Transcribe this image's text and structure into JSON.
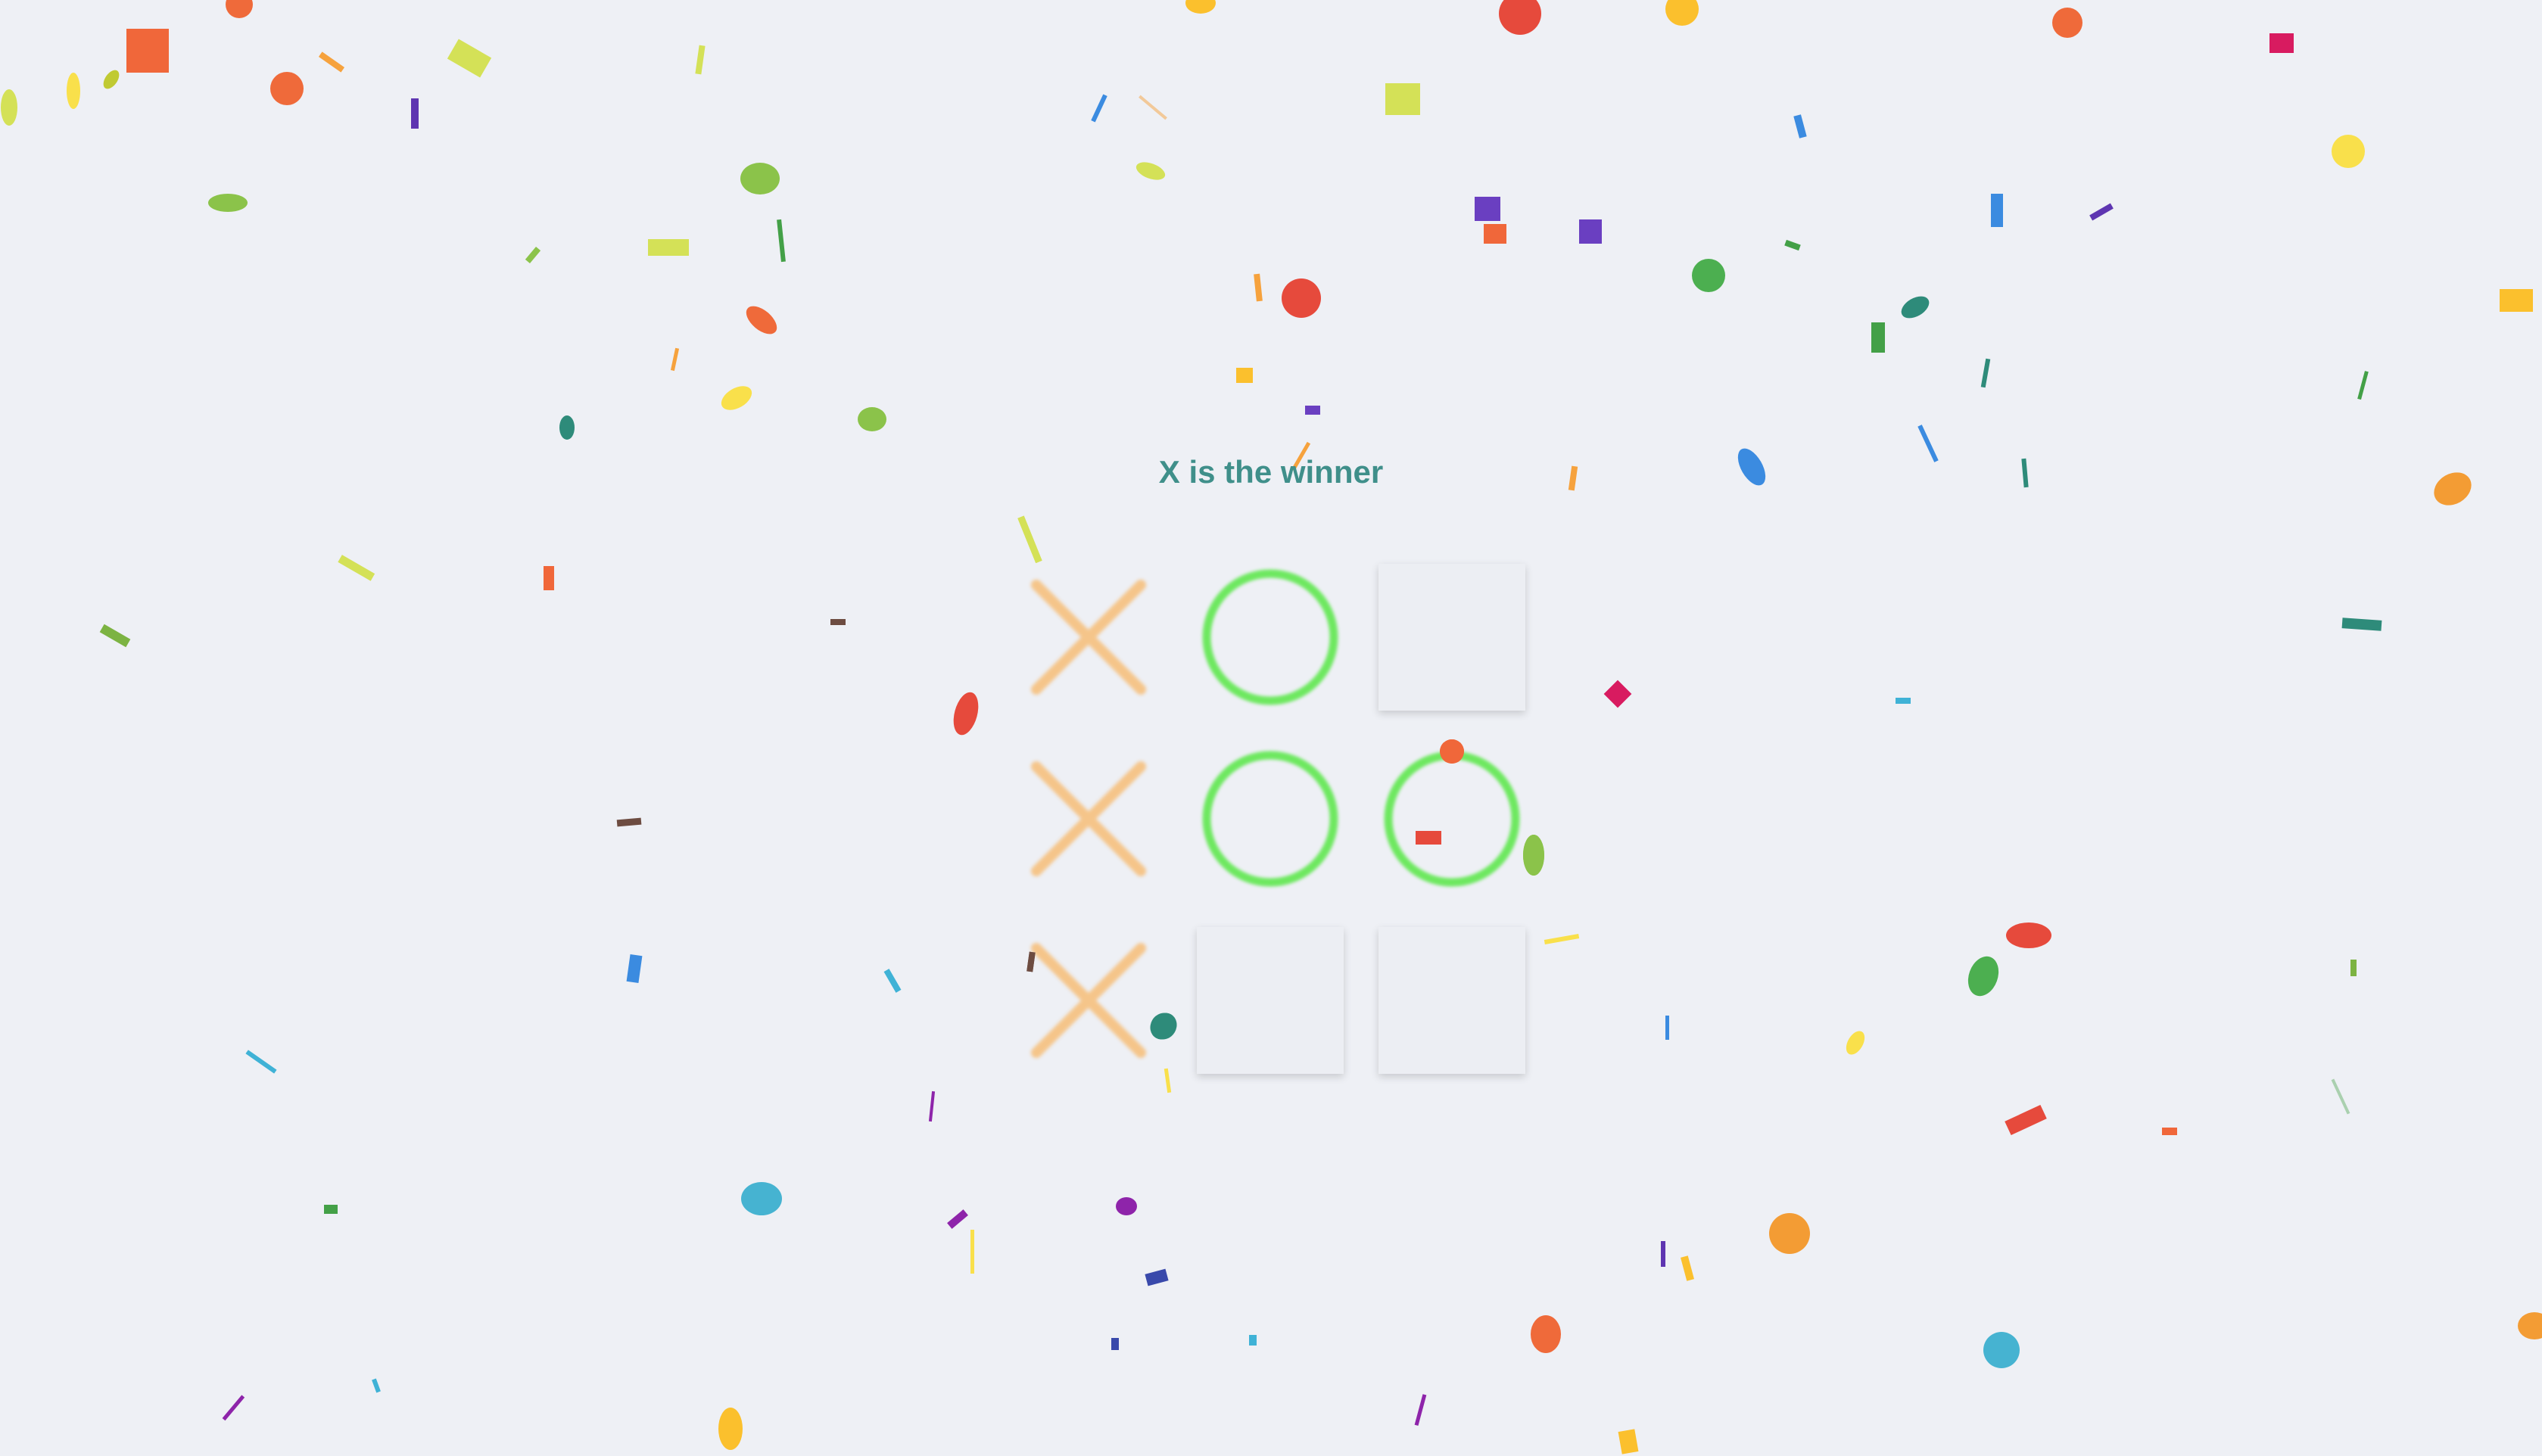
{
  "game": {
    "status_text": "X is the winner",
    "winner": "X",
    "board": [
      [
        "X",
        "O",
        ""
      ],
      [
        "X",
        "O",
        "O"
      ],
      [
        "X",
        "",
        ""
      ]
    ]
  },
  "colors": {
    "background": "#eef0f5",
    "status_text": "#3f8f8a",
    "x_mark": "#f5c58a",
    "o_mark": "#6ee860",
    "empty_cell": "#eceef3"
  }
}
